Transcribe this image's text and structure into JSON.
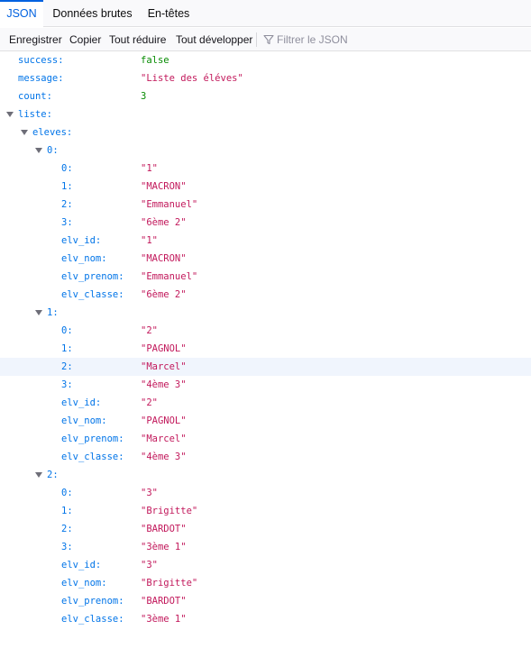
{
  "tabs": {
    "json": "JSON",
    "raw": "Données brutes",
    "headers": "En-têtes"
  },
  "toolbar": {
    "save": "Enregistrer",
    "copy": "Copier",
    "collapse_all": "Tout réduire",
    "expand_all": "Tout développer",
    "filter_placeholder": "Filtrer le JSON"
  },
  "tree": {
    "success": {
      "key": "success:",
      "value": "false"
    },
    "message": {
      "key": "message:",
      "value": "\"Liste des éléves\""
    },
    "count": {
      "key": "count:",
      "value": "3"
    },
    "liste": {
      "key": "liste:"
    },
    "eleves": {
      "key": "eleves:"
    },
    "items": [
      {
        "key": "0:",
        "fields": [
          {
            "key": "0:",
            "value": "\"1\""
          },
          {
            "key": "1:",
            "value": "\"MACRON\""
          },
          {
            "key": "2:",
            "value": "\"Emmanuel\""
          },
          {
            "key": "3:",
            "value": "\"6ème 2\""
          },
          {
            "key": "elv_id:",
            "value": "\"1\""
          },
          {
            "key": "elv_nom:",
            "value": "\"MACRON\""
          },
          {
            "key": "elv_prenom:",
            "value": "\"Emmanuel\""
          },
          {
            "key": "elv_classe:",
            "value": "\"6ème 2\""
          }
        ]
      },
      {
        "key": "1:",
        "fields": [
          {
            "key": "0:",
            "value": "\"2\""
          },
          {
            "key": "1:",
            "value": "\"PAGNOL\""
          },
          {
            "key": "2:",
            "value": "\"Marcel\""
          },
          {
            "key": "3:",
            "value": "\"4ème 3\""
          },
          {
            "key": "elv_id:",
            "value": "\"2\""
          },
          {
            "key": "elv_nom:",
            "value": "\"PAGNOL\""
          },
          {
            "key": "elv_prenom:",
            "value": "\"Marcel\""
          },
          {
            "key": "elv_classe:",
            "value": "\"4ème 3\""
          }
        ]
      },
      {
        "key": "2:",
        "fields": [
          {
            "key": "0:",
            "value": "\"3\""
          },
          {
            "key": "1:",
            "value": "\"Brigitte\""
          },
          {
            "key": "2:",
            "value": "\"BARDOT\""
          },
          {
            "key": "3:",
            "value": "\"3ème 1\""
          },
          {
            "key": "elv_id:",
            "value": "\"3\""
          },
          {
            "key": "elv_nom:",
            "value": "\"Brigitte\""
          },
          {
            "key": "elv_prenom:",
            "value": "\"BARDOT\""
          },
          {
            "key": "elv_classe:",
            "value": "\"3ème 1\""
          }
        ]
      }
    ]
  },
  "colors": {
    "key": "#0074e8",
    "string": "#c2185b",
    "literal": "#058b00",
    "accent": "#0061e0",
    "highlight_row": "#f0f5fd"
  },
  "icons": {
    "filter": "filter-icon",
    "twisty": "twisty-expanded-icon"
  }
}
